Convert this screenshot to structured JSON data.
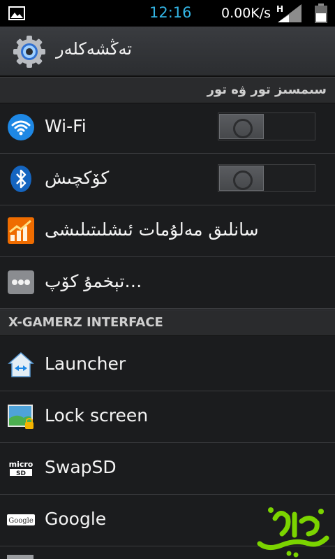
{
  "status_bar": {
    "time": "12:16",
    "speed": "0.00K/s",
    "network_type": "H",
    "icons": [
      "image-icon",
      "signal-icon",
      "battery-icon"
    ]
  },
  "action_bar": {
    "title": "تەڭشەكلەر",
    "icon": "settings-gear-icon"
  },
  "sections": {
    "wireless": "سىمسىز تور ۋە تور",
    "custom": "X-GAMERZ INTERFACE"
  },
  "wireless_items": [
    {
      "label": "Wi-Fi",
      "icon": "wifi-icon",
      "toggle": "off"
    },
    {
      "label": "كۆكچىش",
      "icon": "bluetooth-icon",
      "toggle": "off"
    },
    {
      "label": "سانلىق مەلۇمات ئىشلىتىلىشى",
      "icon": "data-usage-icon"
    },
    {
      "label": "تېخمۇ كۆپ…",
      "icon": "more-icon"
    }
  ],
  "custom_items": [
    {
      "label": "Launcher",
      "icon": "launcher-icon"
    },
    {
      "label": "Lock screen",
      "icon": "lock-screen-icon"
    },
    {
      "label": "SwapSD",
      "icon": "microsd-icon"
    },
    {
      "label": "Google",
      "icon": "google-icon"
    }
  ],
  "colors": {
    "accent": "#33b5e5",
    "background": "#1b1c1e",
    "header": "#2a2b2d"
  }
}
